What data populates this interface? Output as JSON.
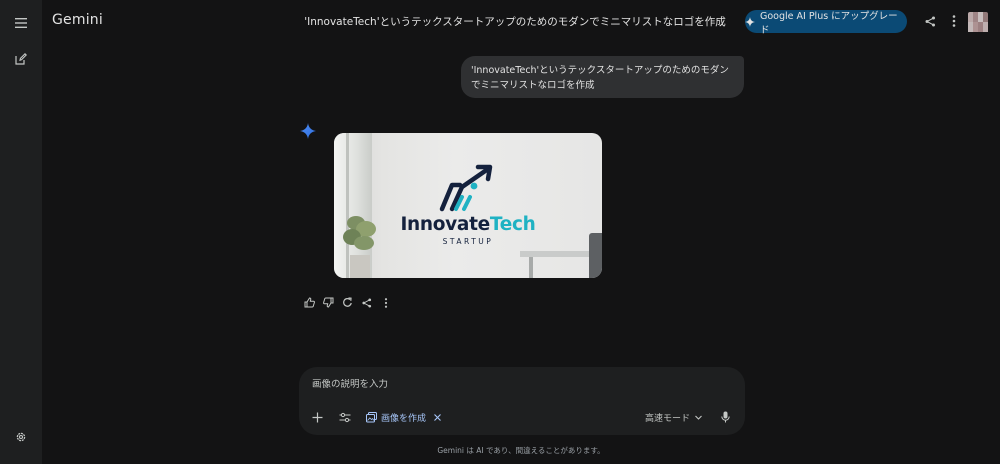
{
  "app": {
    "brand": "Gemini"
  },
  "header": {
    "title": "'InnovateTech'というテックスタートアップのためのモダンでミニマリストなロゴを作成",
    "upgrade_label": "Google AI Plus にアップグレード"
  },
  "conversation": {
    "user_prompt": "'InnovateTech'というテックスタートアップのためのモダンでミニマリストなロゴを作成",
    "image_logo": {
      "name_dark": "Innovate",
      "name_accent": "Tech",
      "tagline": "STARTUP"
    }
  },
  "composer": {
    "placeholder": "画像の説明を入力",
    "tool_chip": "画像を作成",
    "mode_label": "高速モード"
  },
  "footer": {
    "disclaimer": "Gemini は AI であり、間違えることがあります。"
  },
  "colors": {
    "background": "#131314",
    "sidebar": "#1e1f20",
    "upgrade": "#0b4a75",
    "accent_blue": "#a8c7fa",
    "logo_navy": "#14213d",
    "logo_teal": "#1fb2c3"
  },
  "icons": [
    "menu-icon",
    "new-chat-icon",
    "settings-icon",
    "sparkle-icon",
    "share-icon",
    "more-vert-icon",
    "thumb-up-icon",
    "thumb-down-icon",
    "regenerate-icon",
    "add-icon",
    "tune-icon",
    "image-icon",
    "close-icon",
    "chevron-down-icon",
    "mic-icon"
  ]
}
